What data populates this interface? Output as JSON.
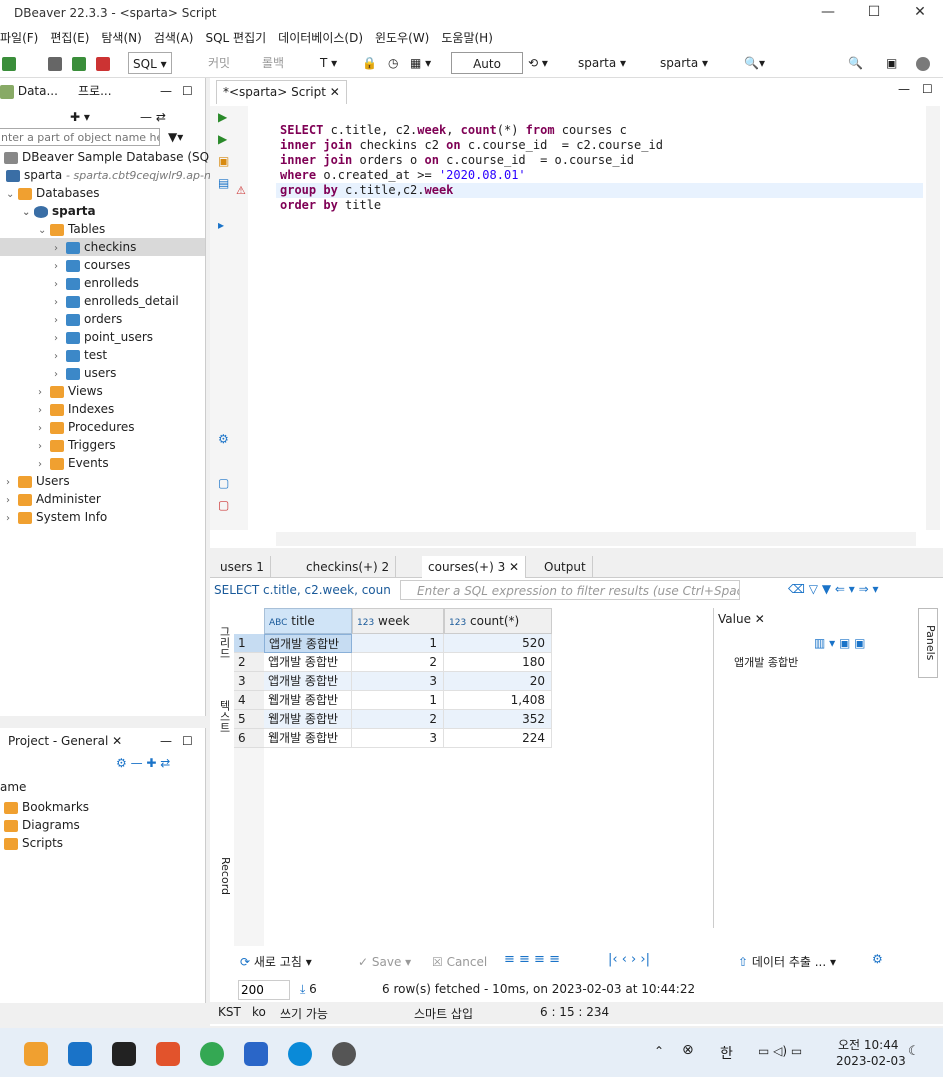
{
  "window": {
    "title": "DBeaver 22.3.3 - <sparta> Script"
  },
  "menu": [
    "파일(F)",
    "편집(E)",
    "탐색(N)",
    "검색(A)",
    "SQL 편집기",
    "데이터베이스(D)",
    "윈도우(W)",
    "도움말(H)"
  ],
  "toolbar": {
    "sql_label": "SQL",
    "commit_label": "커밋",
    "rollback_label": "롤백",
    "tx_mode": "Auto",
    "conn1": "sparta",
    "conn2": "sparta"
  },
  "navigator": {
    "tab1": "Data...",
    "tab2": "프로...",
    "filter_placeholder": "nter a part of object name her",
    "items": [
      {
        "label": "DBeaver Sample Database (SQLite",
        "sub": ""
      },
      {
        "label": "sparta",
        "sub": "- sparta.cbt9ceqjwlr9.ap-n"
      },
      {
        "label": "Databases"
      },
      {
        "label": "sparta"
      },
      {
        "label": "Tables"
      },
      {
        "label": "checkins"
      },
      {
        "label": "courses"
      },
      {
        "label": "enrolleds"
      },
      {
        "label": "enrolleds_detail"
      },
      {
        "label": "orders"
      },
      {
        "label": "point_users"
      },
      {
        "label": "test"
      },
      {
        "label": "users"
      },
      {
        "label": "Views"
      },
      {
        "label": "Indexes"
      },
      {
        "label": "Procedures"
      },
      {
        "label": "Triggers"
      },
      {
        "label": "Events"
      },
      {
        "label": "Users"
      },
      {
        "label": "Administer"
      },
      {
        "label": "System Info"
      }
    ]
  },
  "project": {
    "tab": "Project - General",
    "col": "ame",
    "items": [
      "Bookmarks",
      "Diagrams",
      "Scripts"
    ]
  },
  "editor": {
    "tab": "*<sparta> Script",
    "lines": [
      "SELECT c.title, c2.week, count(*) from courses c",
      "inner join checkins c2 on c.course_id  = c2.course_id",
      "inner join orders o on c.course_id  = o.course_id",
      "where o.created_at >= '2020.08.01'",
      "group by c.title,c2.week",
      "order by title"
    ]
  },
  "results": {
    "tabs": [
      "users 1",
      "checkins(+) 2",
      "courses(+) 3",
      "Output"
    ],
    "query_preview": "SELECT c.title, c2.week, coun",
    "filter_placeholder": "Enter a SQL expression to filter results (use Ctrl+Space)",
    "columns": [
      "title",
      "week",
      "count(*)"
    ],
    "rows": [
      [
        "앱개발 종합반",
        "1",
        "520"
      ],
      [
        "앱개발 종합반",
        "2",
        "180"
      ],
      [
        "앱개발 종합반",
        "3",
        "20"
      ],
      [
        "웹개발 종합반",
        "1",
        "1,408"
      ],
      [
        "웹개발 종합반",
        "2",
        "352"
      ],
      [
        "웹개발 종합반",
        "3",
        "224"
      ]
    ],
    "value_tab": "Value",
    "value_text": "앱개발 종합반",
    "side_grid": "그리드",
    "side_text": "텍스트",
    "side_record": "Record",
    "panels": "Panels",
    "refresh": "새로 고침",
    "save": "Save",
    "cancel": "Cancel",
    "export": "데이터 추출 ...",
    "fetch_size": "200",
    "row_count": "6",
    "status_msg": "6 row(s) fetched - 10ms, on 2023-02-03 at 10:44:22"
  },
  "statusbar": {
    "tz": "KST",
    "lang": "ko",
    "mode": "쓰기 가능",
    "insert": "스마트 삽입",
    "pos": "6 : 15 : 234"
  },
  "taskbar": {
    "ime": "한",
    "time": "오전 10:44",
    "date": "2023-02-03"
  }
}
